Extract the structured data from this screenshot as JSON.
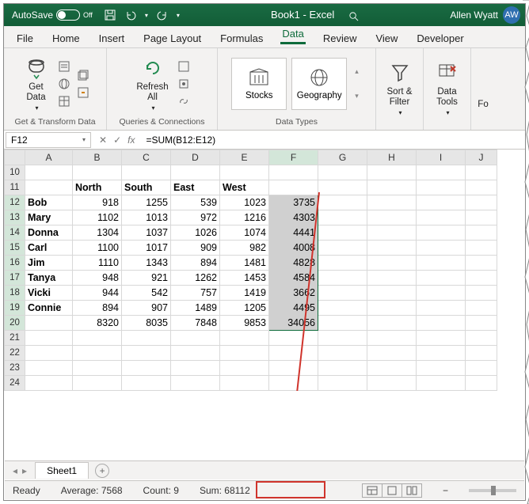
{
  "titlebar": {
    "autosave_label": "AutoSave",
    "autosave_state": "Off",
    "doc_title": "Book1 - Excel",
    "user_name": "Allen Wyatt",
    "user_initials": "AW"
  },
  "tabs": [
    "File",
    "Home",
    "Insert",
    "Page Layout",
    "Formulas",
    "Data",
    "Review",
    "View",
    "Developer"
  ],
  "active_tab": "Data",
  "ribbon": {
    "group1_label": "Get & Transform Data",
    "get_data": "Get\nData",
    "group2_label": "Queries & Connections",
    "refresh_all": "Refresh\nAll",
    "group3_label": "Data Types",
    "stocks": "Stocks",
    "geography": "Geography",
    "sort_filter": "Sort &\nFilter",
    "data_tools": "Data\nTools",
    "forecast_partial": "Fo"
  },
  "namebox": "F12",
  "fx_label": "fx",
  "formula": "=SUM(B12:E12)",
  "columns": [
    "A",
    "B",
    "C",
    "D",
    "E",
    "F",
    "G",
    "H",
    "I",
    "J"
  ],
  "row_start": 10,
  "row_end": 24,
  "data_headers_row": 11,
  "data_headers": {
    "B": "North",
    "C": "South",
    "D": "East",
    "E": "West"
  },
  "rows": [
    {
      "r": 12,
      "A": "Bob",
      "B": 918,
      "C": 1255,
      "D": 539,
      "E": 1023,
      "F": 3735
    },
    {
      "r": 13,
      "A": "Mary",
      "B": 1102,
      "C": 1013,
      "D": 972,
      "E": 1216,
      "F": 4303
    },
    {
      "r": 14,
      "A": "Donna",
      "B": 1304,
      "C": 1037,
      "D": 1026,
      "E": 1074,
      "F": 4441
    },
    {
      "r": 15,
      "A": "Carl",
      "B": 1100,
      "C": 1017,
      "D": 909,
      "E": 982,
      "F": 4008
    },
    {
      "r": 16,
      "A": "Jim",
      "B": 1110,
      "C": 1343,
      "D": 894,
      "E": 1481,
      "F": 4828
    },
    {
      "r": 17,
      "A": "Tanya",
      "B": 948,
      "C": 921,
      "D": 1262,
      "E": 1453,
      "F": 4584
    },
    {
      "r": 18,
      "A": "Vicki",
      "B": 944,
      "C": 542,
      "D": 757,
      "E": 1419,
      "F": 3662
    },
    {
      "r": 19,
      "A": "Connie",
      "B": 894,
      "C": 907,
      "D": 1489,
      "E": 1205,
      "F": 4495
    },
    {
      "r": 20,
      "A": "",
      "B": 8320,
      "C": 8035,
      "D": 7848,
      "E": 9853,
      "F": 34056
    }
  ],
  "selected_range": "F12:F20",
  "sheet": {
    "active": "Sheet1"
  },
  "status": {
    "ready": "Ready",
    "average_label": "Average:",
    "average_value": "7568",
    "count_label": "Count:",
    "count_value": "9",
    "sum_label": "Sum:",
    "sum_value": "68112"
  }
}
